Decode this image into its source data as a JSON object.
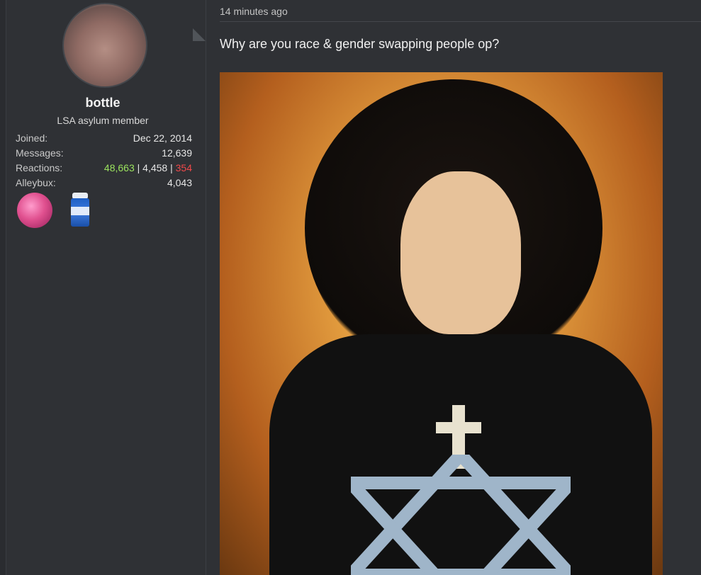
{
  "user": {
    "username": "bottle",
    "title": "LSA asylum member",
    "stats": [
      {
        "label": "Joined:",
        "value": "Dec 22, 2014"
      },
      {
        "label": "Messages:",
        "value": "12,639"
      },
      {
        "label": "Reactions:",
        "value_parts": [
          "48,663",
          " | ",
          "4,458",
          " | ",
          "354"
        ]
      },
      {
        "label": "Alleybux:",
        "value": "4,043"
      }
    ],
    "badges": [
      "pink-moon-badge-icon",
      "disinfectant-can-badge-icon"
    ]
  },
  "post": {
    "time": "14 minutes ago",
    "text": "Why are you race & gender swapping people op?"
  },
  "colors": {
    "background": "#2f3135",
    "positive": "#9be35e",
    "negative": "#f0494a"
  }
}
